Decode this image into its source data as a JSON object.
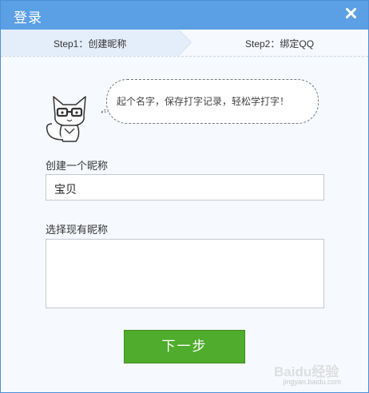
{
  "window": {
    "title": "登录"
  },
  "steps": [
    {
      "label": "Step1：创建昵称",
      "active": true
    },
    {
      "label": "Step2：绑定QQ",
      "active": false
    }
  ],
  "mascot": {
    "icon": "cat-mascot-icon"
  },
  "bubble": {
    "text": "起个名字，保存打字记录，轻松学打字！"
  },
  "form": {
    "nickname_label": "创建一个昵称",
    "nickname_value": "宝贝",
    "existing_label": "选择现有昵称"
  },
  "next_button": {
    "label": "下一步"
  },
  "watermark": {
    "text": "Baidu经验",
    "sub": "jingyan.baidu.com"
  },
  "colors": {
    "titlebar": "#5b9fe4",
    "button": "#4fac2c"
  }
}
